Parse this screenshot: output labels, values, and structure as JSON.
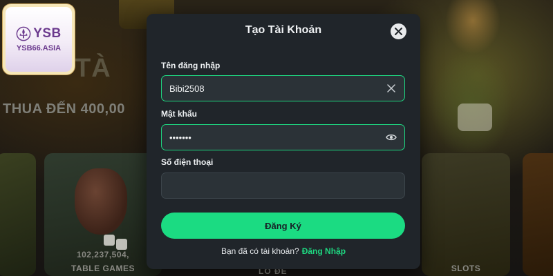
{
  "background": {
    "hero_text": "THUA ĐẾN 400,00",
    "hero_big_letters": "TÀ",
    "cards": [
      {
        "number": "102,237,504,",
        "label": "TABLE GAMES"
      },
      {
        "label": "LÔ ĐỀ"
      },
      {
        "label": "SLOTS"
      }
    ]
  },
  "logo": {
    "brand": "YSB",
    "domain": "YSB66.ASIA",
    "mark_icon": "fleur-de-lis-icon"
  },
  "modal": {
    "title": "Tạo Tài Khoản",
    "close_icon": "close-icon",
    "fields": {
      "username": {
        "label": "Tên đăng nhập",
        "value": "Bibi2508",
        "icon": "clear-x-icon"
      },
      "password": {
        "label": "Mật khẩu",
        "value": "bibi250",
        "icon": "eye-icon"
      },
      "phone": {
        "label": "Số điện thoại",
        "value": ""
      }
    },
    "submit_label": "Đăng Ký",
    "footer_prompt": "Bạn đã có tài khoản?",
    "footer_link": "Đăng Nhập"
  },
  "colors": {
    "accent": "#1ed680",
    "modal_bg": "#20252a",
    "input_bg": "#2b3237",
    "logo_purple": "#6b3a8e"
  }
}
